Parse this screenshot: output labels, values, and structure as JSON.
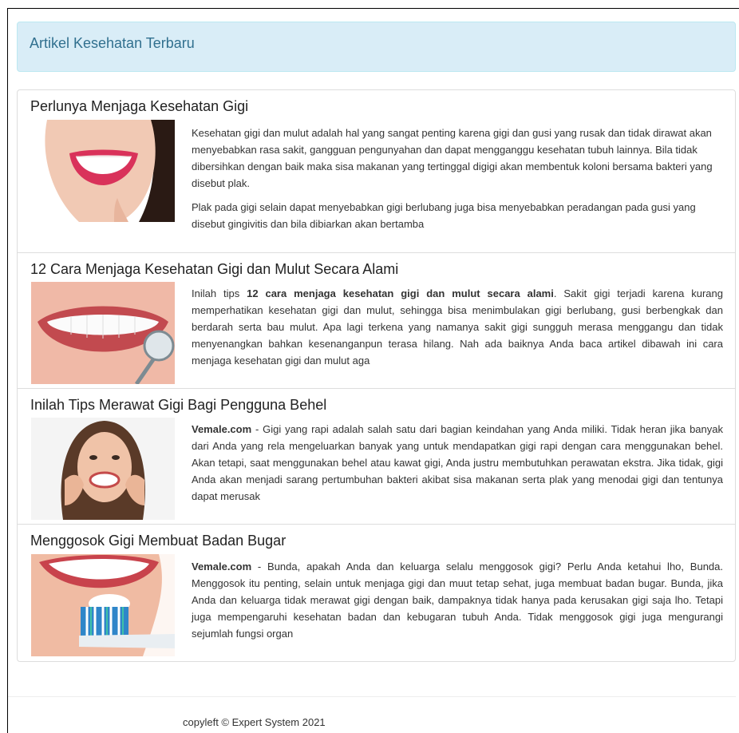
{
  "alert": {
    "title": "Artikel Kesehatan Terbaru"
  },
  "articles": [
    {
      "title": "Perlunya Menjaga Kesehatan Gigi",
      "image_icon": "smiling-mouth-photo",
      "paragraphs": [
        "Kesehatan gigi dan mulut adalah hal yang sangat penting karena gigi dan gusi yang rusak dan tidak dirawat akan menyebabkan rasa sakit, gangguan pengunyahan dan dapat mengganggu kesehatan tubuh lainnya. Bila tidak dibersihkan dengan baik maka sisa makanan yang tertinggal digigi akan membentuk koloni bersama bakteri yang disebut plak.",
        "Plak pada gigi selain dapat menyebabkan gigi berlubang juga bisa menyebabkan peradangan pada gusi yang disebut gingivitis dan bila dibiarkan akan bertamba"
      ]
    },
    {
      "title": "12 Cara Menjaga Kesehatan Gigi dan Mulut Secara Alami",
      "image_icon": "teeth-with-dental-mirror-photo",
      "lead_plain": "Inilah tips ",
      "lead_bold": "12 cara menjaga kesehatan gigi dan mulut secara alami",
      "body": ". Sakit gigi terjadi karena kurang memperhatikan kesehatan gigi dan mulut, sehingga bisa menimbulakan gigi berlubang, gusi berbengkak dan berdarah serta bau mulut. Apa lagi terkena yang namanya sakit gigi sungguh merasa menggangu dan tidak menyenangkan bahkan kesenanganpun terasa hilang. Nah ada baiknya Anda baca artikel dibawah ini cara menjaga kesehatan gigi dan mulut aga"
    },
    {
      "title": "Inilah Tips Merawat Gigi Bagi Pengguna Behel",
      "image_icon": "woman-smiling-photo",
      "lead_bold": "Vemale.com",
      "body": " - Gigi yang rapi adalah salah satu dari bagian keindahan yang Anda miliki. Tidak heran jika banyak dari Anda yang rela mengeluarkan banyak yang untuk mendapatkan gigi rapi dengan cara menggunakan behel. Akan tetapi, saat menggunakan behel atau kawat gigi, Anda justru membutuhkan perawatan ekstra. Jika tidak, gigi Anda akan menjadi sarang pertumbuhan bakteri akibat sisa makanan serta plak yang menodai gigi dan tentunya dapat merusak"
    },
    {
      "title": "Menggosok Gigi Membuat Badan Bugar",
      "image_icon": "toothbrush-and-teeth-photo",
      "lead_bold": "Vemale.com",
      "body": " - Bunda, apakah Anda dan keluarga selalu menggosok gigi? Perlu Anda ketahui lho, Bunda. Menggosok itu penting, selain untuk menjaga gigi dan muut tetap sehat, juga membuat badan bugar. Bunda, jika Anda dan keluarga tidak merawat gigi dengan baik, dampaknya tidak hanya pada kerusakan gigi saja lho. Tetapi juga mempengaruhi kesehatan badan dan kebugaran tubuh Anda. Tidak menggosok gigi juga mengurangi sejumlah fungsi organ"
    }
  ],
  "footer": {
    "text": "copyleft © Expert System 2021"
  },
  "colors": {
    "alert_bg": "#d9edf7",
    "alert_text": "#31708f",
    "border": "#dddddd"
  }
}
